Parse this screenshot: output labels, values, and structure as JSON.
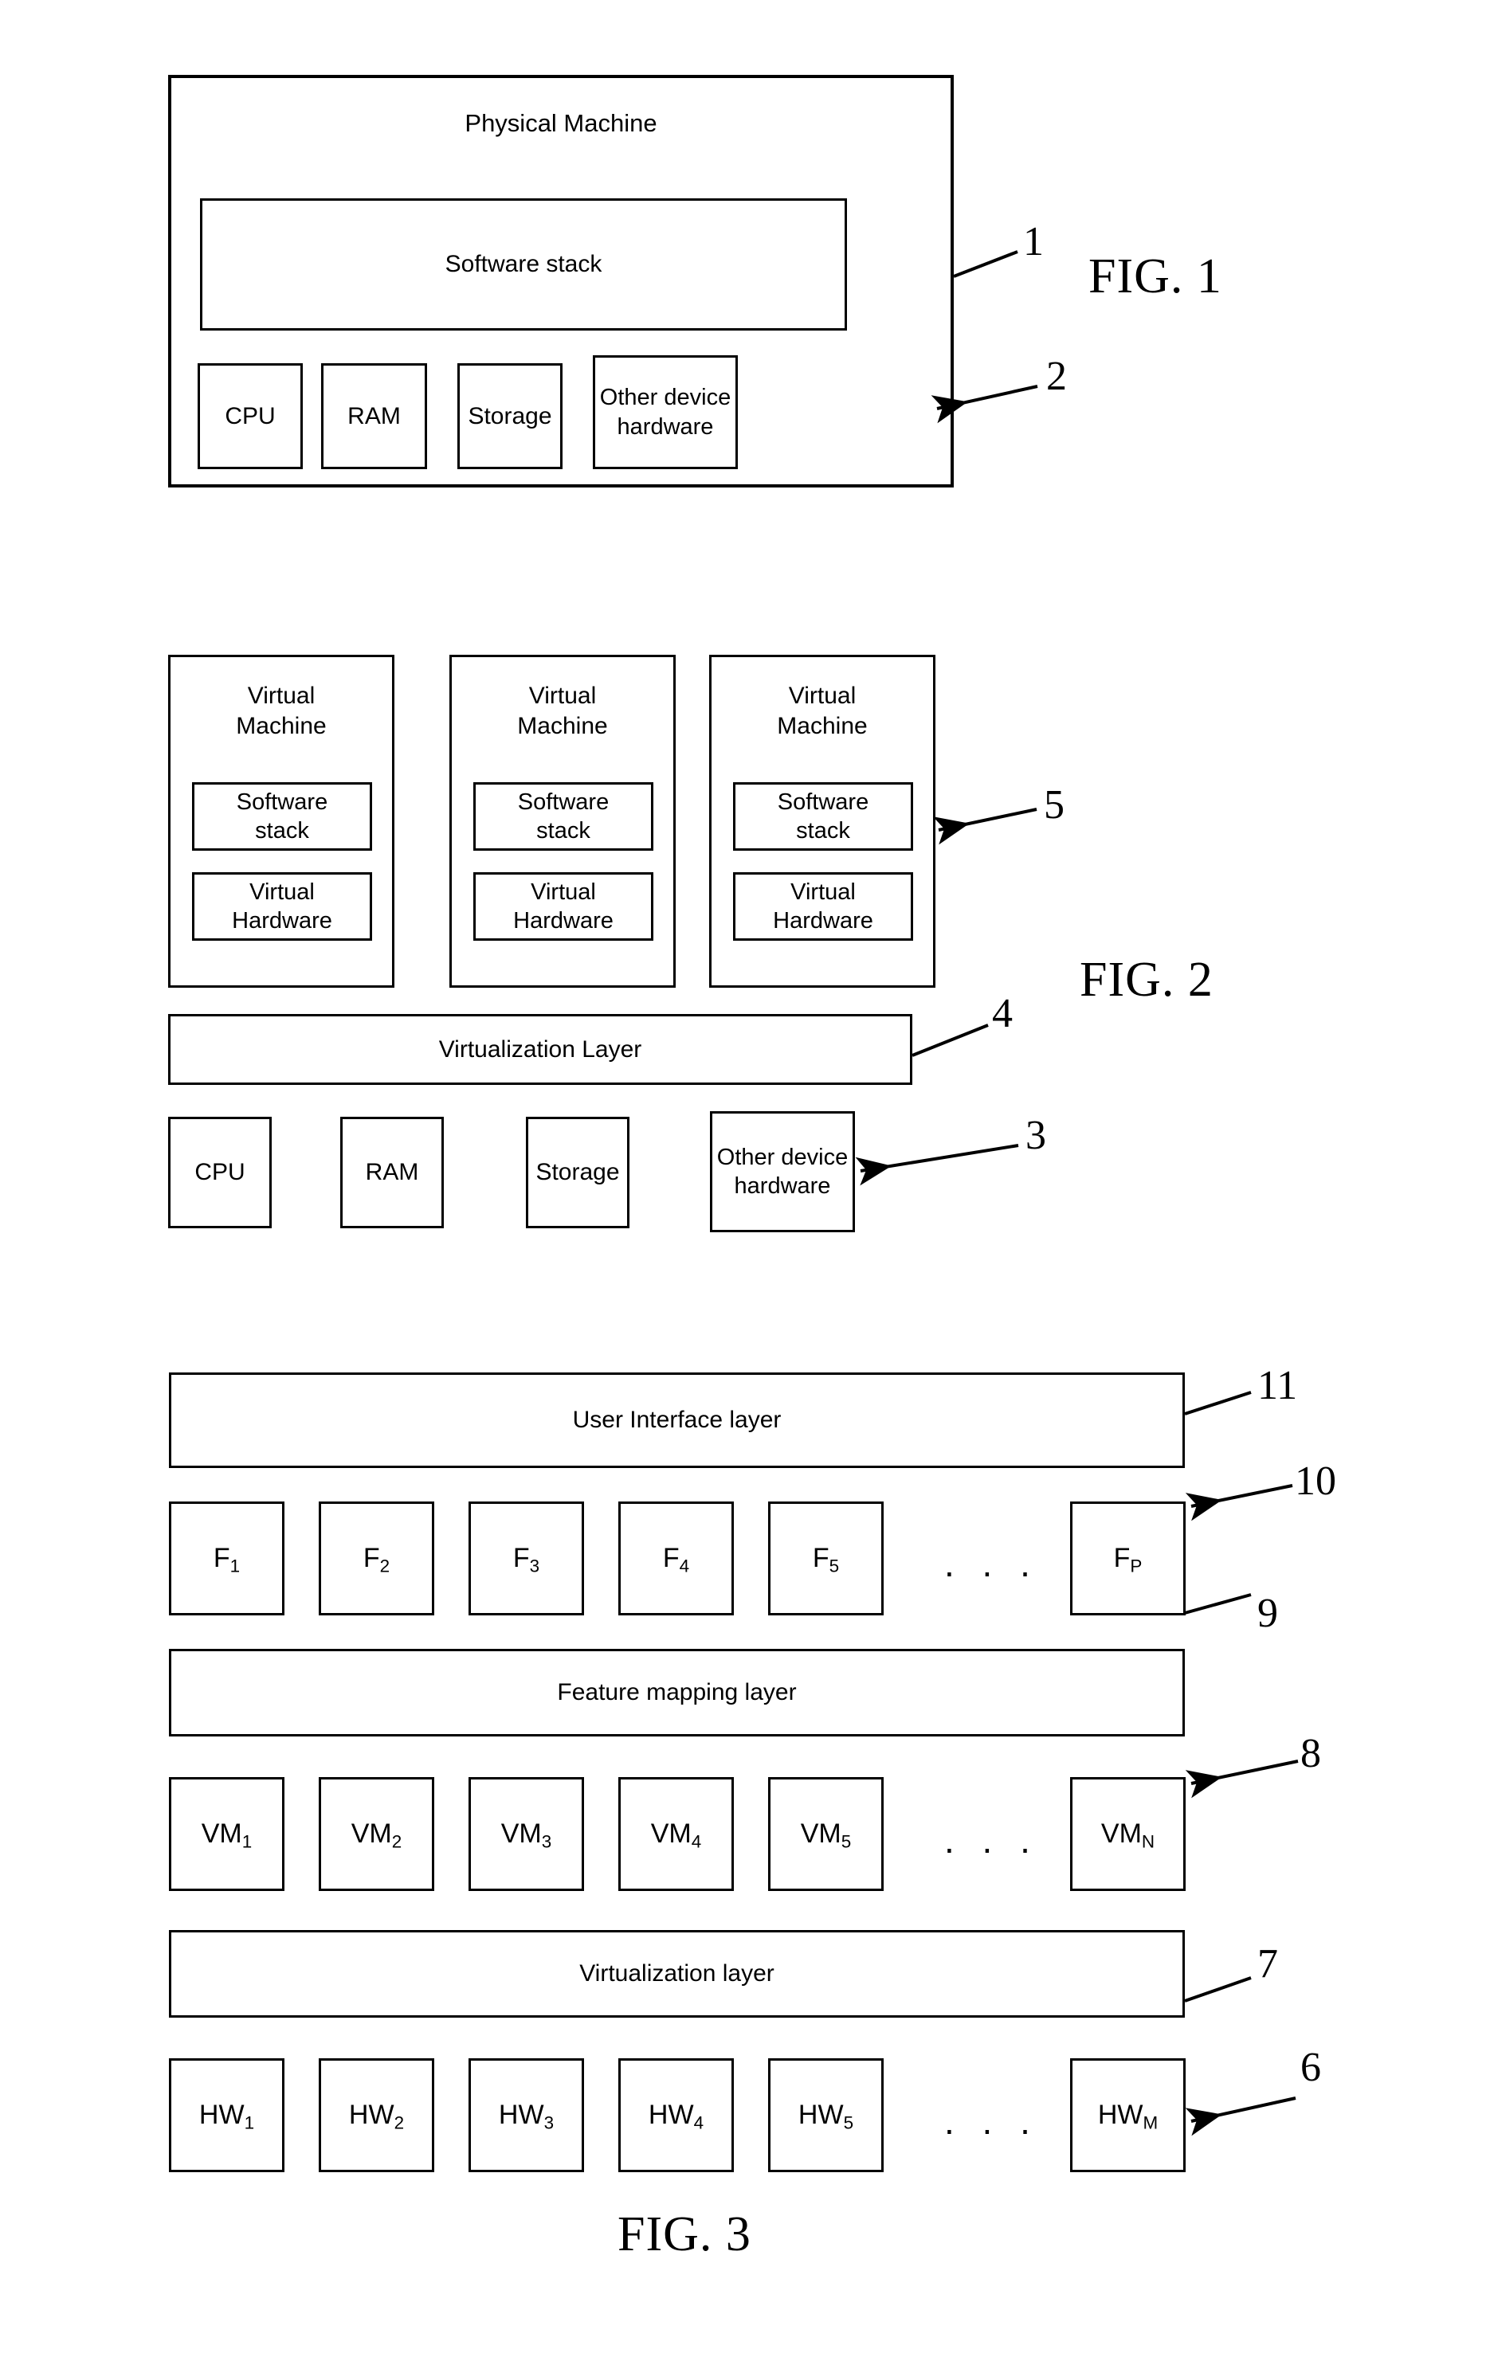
{
  "figures": [
    {
      "caption": "FIG. 1",
      "container_label": "Physical Machine",
      "software_stack_label": "Software stack",
      "hardware": [
        {
          "label": "CPU"
        },
        {
          "label": "RAM"
        },
        {
          "label": "Storage"
        },
        {
          "label": "Other device\nhardware"
        }
      ],
      "refs": [
        {
          "numeral": "1",
          "target": "physical-machine-container",
          "arrow": false
        },
        {
          "numeral": "2",
          "target": "other-device-hardware-box",
          "arrow": true
        }
      ]
    },
    {
      "caption": "FIG. 2",
      "virtual_machines": [
        {
          "title": "Virtual\nMachine",
          "software_stack": "Software\nstack",
          "virtual_hardware": "Virtual\nHardware"
        },
        {
          "title": "Virtual\nMachine",
          "software_stack": "Software\nstack",
          "virtual_hardware": "Virtual\nHardware"
        },
        {
          "title": "Virtual\nMachine",
          "software_stack": "Software\nstack",
          "virtual_hardware": "Virtual\nHardware"
        }
      ],
      "virtualization_layer_label": "Virtualization Layer",
      "hardware": [
        {
          "label": "CPU"
        },
        {
          "label": "RAM"
        },
        {
          "label": "Storage"
        },
        {
          "label": "Other device\nhardware"
        }
      ],
      "refs": [
        {
          "numeral": "5",
          "target": "virtual-machine-box-3",
          "arrow": true
        },
        {
          "numeral": "4",
          "target": "virtualization-layer-bar",
          "arrow": false
        },
        {
          "numeral": "3",
          "target": "other-device-hardware-box",
          "arrow": true
        }
      ]
    },
    {
      "caption": "FIG. 3",
      "user_interface_layer_label": "User Interface layer",
      "feature_boxes": [
        {
          "base": "F",
          "sub": "1"
        },
        {
          "base": "F",
          "sub": "2"
        },
        {
          "base": "F",
          "sub": "3"
        },
        {
          "base": "F",
          "sub": "4"
        },
        {
          "base": "F",
          "sub": "5"
        },
        {
          "base": "F",
          "sub": "P"
        }
      ],
      "feature_mapping_layer_label": "Feature mapping layer",
      "vm_boxes": [
        {
          "base": "VM",
          "sub": "1"
        },
        {
          "base": "VM",
          "sub": "2"
        },
        {
          "base": "VM",
          "sub": "3"
        },
        {
          "base": "VM",
          "sub": "4"
        },
        {
          "base": "VM",
          "sub": "5"
        },
        {
          "base": "VM",
          "sub": "N"
        }
      ],
      "virtualization_layer_label": "Virtualization layer",
      "hw_boxes": [
        {
          "base": "HW",
          "sub": "1"
        },
        {
          "base": "HW",
          "sub": "2"
        },
        {
          "base": "HW",
          "sub": "3"
        },
        {
          "base": "HW",
          "sub": "4"
        },
        {
          "base": "HW",
          "sub": "5"
        },
        {
          "base": "HW",
          "sub": "M"
        }
      ],
      "ellipsis": ". . .",
      "refs": [
        {
          "numeral": "11",
          "target": "user-interface-layer-bar",
          "arrow": false
        },
        {
          "numeral": "10",
          "target": "feature-box-p",
          "arrow": true
        },
        {
          "numeral": "9",
          "target": "feature-mapping-layer-bar",
          "arrow": false
        },
        {
          "numeral": "8",
          "target": "vm-box-n",
          "arrow": true
        },
        {
          "numeral": "7",
          "target": "virtualization-layer-bar",
          "arrow": false
        },
        {
          "numeral": "6",
          "target": "hw-box-m",
          "arrow": true
        }
      ]
    }
  ],
  "colors": {
    "stroke": "#000000",
    "background": "#ffffff"
  }
}
